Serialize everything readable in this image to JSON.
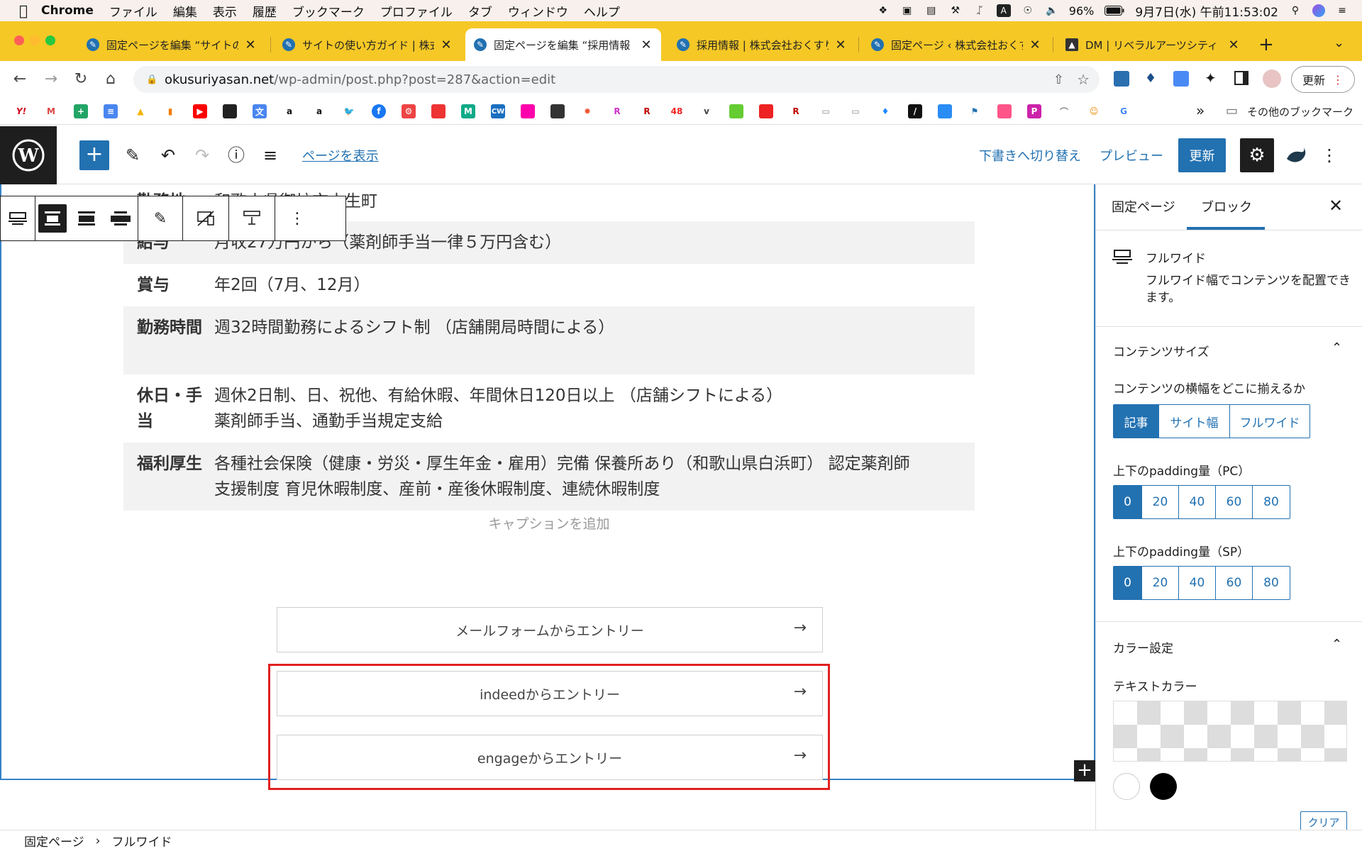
{
  "menubar": {
    "app_name": "Chrome",
    "items": [
      "ファイル",
      "編集",
      "表示",
      "履歴",
      "ブックマーク",
      "プロファイル",
      "タブ",
      "ウィンドウ",
      "ヘルプ"
    ],
    "battery": "96%",
    "datetime": "9月7日(水) 午前11:53:02"
  },
  "tabs": [
    {
      "title": "固定ページを編集 “サイトの",
      "active": false
    },
    {
      "title": "サイトの使い方ガイド | 株式",
      "active": false
    },
    {
      "title": "固定ページを編集 “採用情報",
      "active": true
    },
    {
      "title": "採用情報 | 株式会社おくすり",
      "active": false
    },
    {
      "title": "固定ページ ‹ 株式会社おくす",
      "active": false
    },
    {
      "title": "DM | リベラルアーツシティ",
      "active": false
    }
  ],
  "address": {
    "host": "okusuriyasan.net",
    "path": "/wp-admin/post.php?post=287&action=edit",
    "update_button": "更新"
  },
  "bookmarks": {
    "other_label": "その他のブックマーク",
    "chevron": "»"
  },
  "wp": {
    "view_page": "ページを表示",
    "switch_draft": "下書きへ切り替え",
    "preview": "プレビュー",
    "update": "更新"
  },
  "table": {
    "partial_row": {
      "label": "勤務地",
      "value": "和歌山県御坊市土生町"
    },
    "rows": [
      {
        "label": "給与",
        "value": "月収27万円から（薬剤師手当一律５万円含む）"
      },
      {
        "label": "賞与",
        "value": "年2回（7月、12月）"
      },
      {
        "label": "勤務時間",
        "value": "週32時間勤務によるシフト制 （店舗開局時間による）"
      },
      {
        "label": "休日・手当",
        "value": "週休2日制、日、祝他、有給休暇、年間休日120日以上 （店舗シフトによる）",
        "value2": "薬剤師手当、通勤手当規定支給"
      },
      {
        "label": "福利厚生",
        "value": "各種社会保険（健康・労災・厚生年金・雇用）完備 保養所あり（和歌山県白浜町） 認定薬剤師",
        "value2": "支援制度 育児休暇制度、産前・産後休暇制度、連続休暇制度"
      }
    ],
    "caption_placeholder": "キャプションを追加"
  },
  "entries": [
    {
      "label": "メールフォームからエントリー",
      "arrow": "→"
    },
    {
      "label": "indeedからエントリー",
      "arrow": "→"
    },
    {
      "label": "engageからエントリー",
      "arrow": "→"
    }
  ],
  "sidebar": {
    "tab_page": "固定ページ",
    "tab_block": "ブロック",
    "block_name": "フルワイド",
    "block_desc": "フルワイド幅でコンテンツを配置できます。",
    "content_size_title": "コンテンツサイズ",
    "content_align_label": "コンテンツの横幅をどこに揃えるか",
    "align_options": [
      "記事",
      "サイト幅",
      "フルワイド"
    ],
    "align_selected": "記事",
    "padding_pc_label": "上下のpadding量（PC）",
    "padding_sp_label": "上下のpadding量（SP）",
    "padding_options": [
      "0",
      "20",
      "40",
      "60",
      "80"
    ],
    "padding_selected": "0",
    "color_title": "カラー設定",
    "text_color_label": "テキストカラー",
    "clear": "クリア"
  },
  "footer": {
    "crumb1": "固定ページ",
    "sep": "›",
    "crumb2": "フルワイド"
  },
  "colors": {
    "wp_blue": "#2271b1",
    "tab_strip": "#f5c826",
    "highlight_red": "#e02020"
  }
}
